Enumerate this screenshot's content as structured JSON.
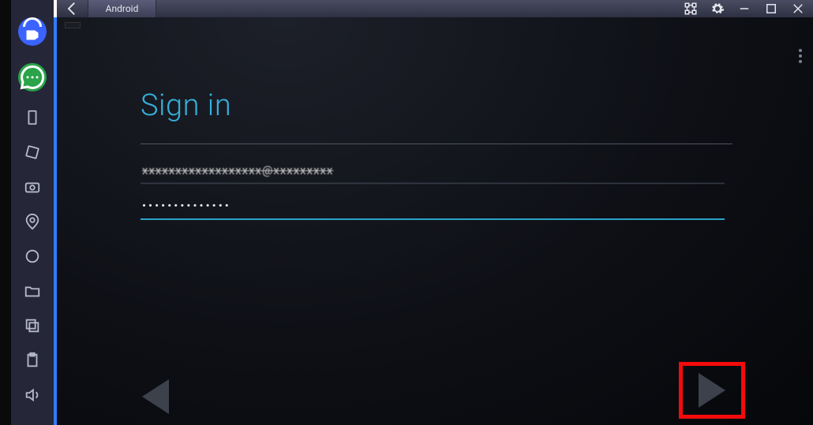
{
  "window": {
    "tab_label": "Android"
  },
  "form": {
    "title": "Sign in",
    "email_value": "xxxxxxxxxxxxxxxxxx@xxxxxxxxx",
    "password_value": "••••••••••••••"
  },
  "sidebar_icons": [
    "camera-wifi-icon",
    "chat-icon",
    "device-icon",
    "rotate-icon",
    "snapshot-icon",
    "location-icon",
    "apk-icon",
    "folder-icon",
    "copy-icon",
    "clipboard-icon",
    "volume-icon"
  ],
  "system_icons": [
    "app-layout-icon",
    "gear-icon",
    "minimize-icon",
    "maximize-icon",
    "close-icon"
  ]
}
